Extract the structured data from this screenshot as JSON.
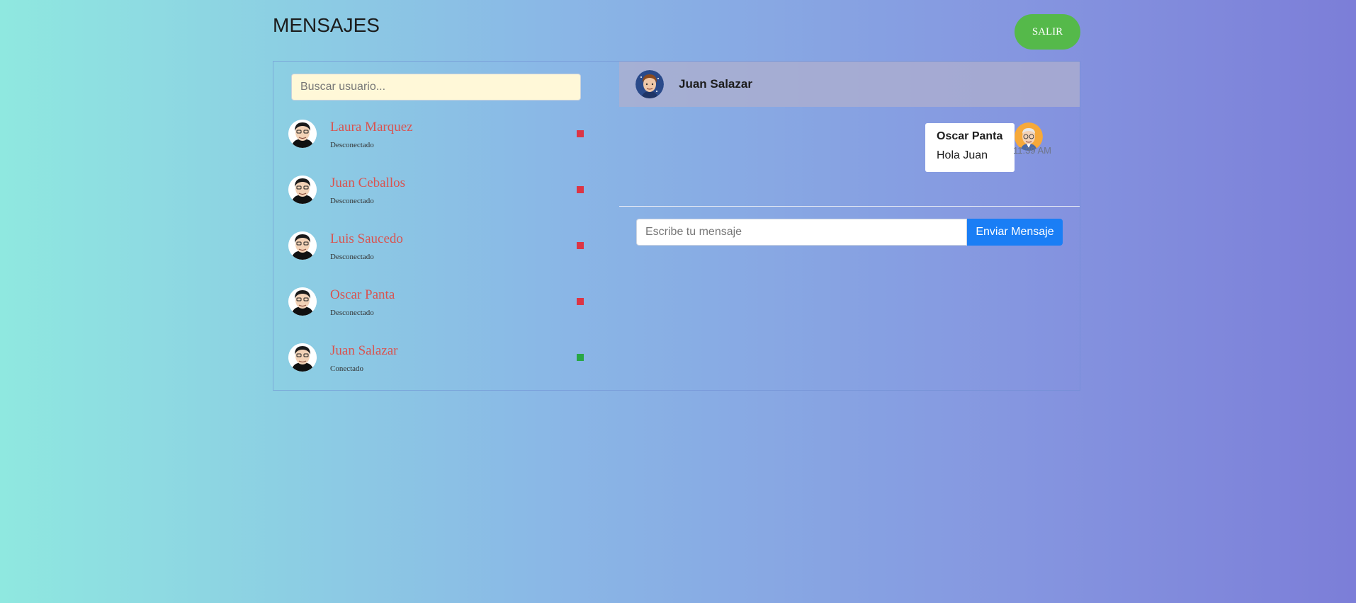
{
  "header": {
    "title": "MENSAJES",
    "logout_label": "SALIR"
  },
  "search": {
    "placeholder": "Buscar usuario..."
  },
  "users": [
    {
      "name": "Laura Marquez",
      "status": "Desconectado",
      "online": false
    },
    {
      "name": "Juan Ceballos",
      "status": "Desconectado",
      "online": false
    },
    {
      "name": "Luis Saucedo",
      "status": "Desconectado",
      "online": false
    },
    {
      "name": "Oscar Panta",
      "status": "Desconectado",
      "online": false
    },
    {
      "name": "Juan Salazar",
      "status": "Conectado",
      "online": true
    }
  ],
  "conversation": {
    "contact_name": "Juan Salazar",
    "messages": [
      {
        "sender": "Oscar Panta",
        "text": "Hola Juan",
        "time": "11:39 AM"
      }
    ],
    "compose_placeholder": "Escribe tu mensaje",
    "send_label": "Enviar Mensaje"
  },
  "colors": {
    "online": "#28a745",
    "offline": "#dc3545",
    "logout": "#55b94a",
    "send": "#1a7ef5",
    "user_name": "#d9534f"
  },
  "icons": {
    "user_avatar": "cartoon-man-avatar-icon",
    "contact_avatar": "cartoon-boy-avatar-icon",
    "sender_avatar": "cartoon-elder-avatar-icon"
  }
}
